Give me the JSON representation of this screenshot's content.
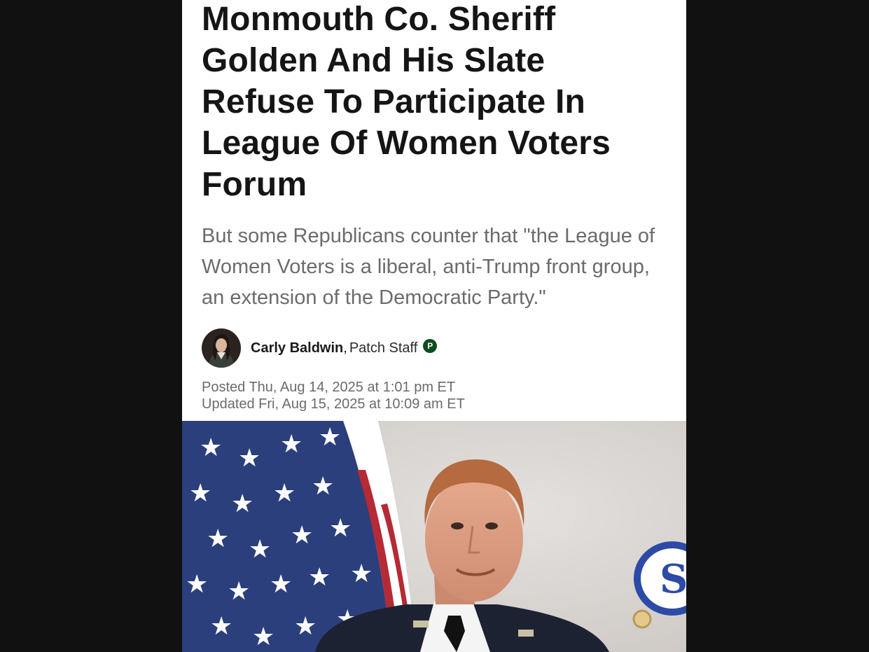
{
  "article": {
    "headline": "Monmouth Co. Sheriff Golden And His Slate Refuse To Participate In League Of Women Voters Forum",
    "dek": "But some Republicans counter that \"the League of Women Voters is a liberal, anti-Trump front group, an extension of the Democratic Party.\"",
    "author": {
      "name": "Carly Baldwin",
      "comma": ",",
      "role": "Patch Staff",
      "badge_letter": "P",
      "avatar_icon": "author-avatar"
    },
    "posted": "Posted Thu, Aug 14, 2025 at 1:01 pm ET",
    "updated": "Updated Fri, Aug 15, 2025 at 10:09 am ET",
    "comments": {
      "icon": "comments-icon"
    },
    "hero_image": "sheriff-photo"
  },
  "colors": {
    "background": "#111111",
    "page": "#ffffff",
    "headline": "#151515",
    "dek": "#6b6b6b",
    "badge": "#0d4d1f"
  }
}
